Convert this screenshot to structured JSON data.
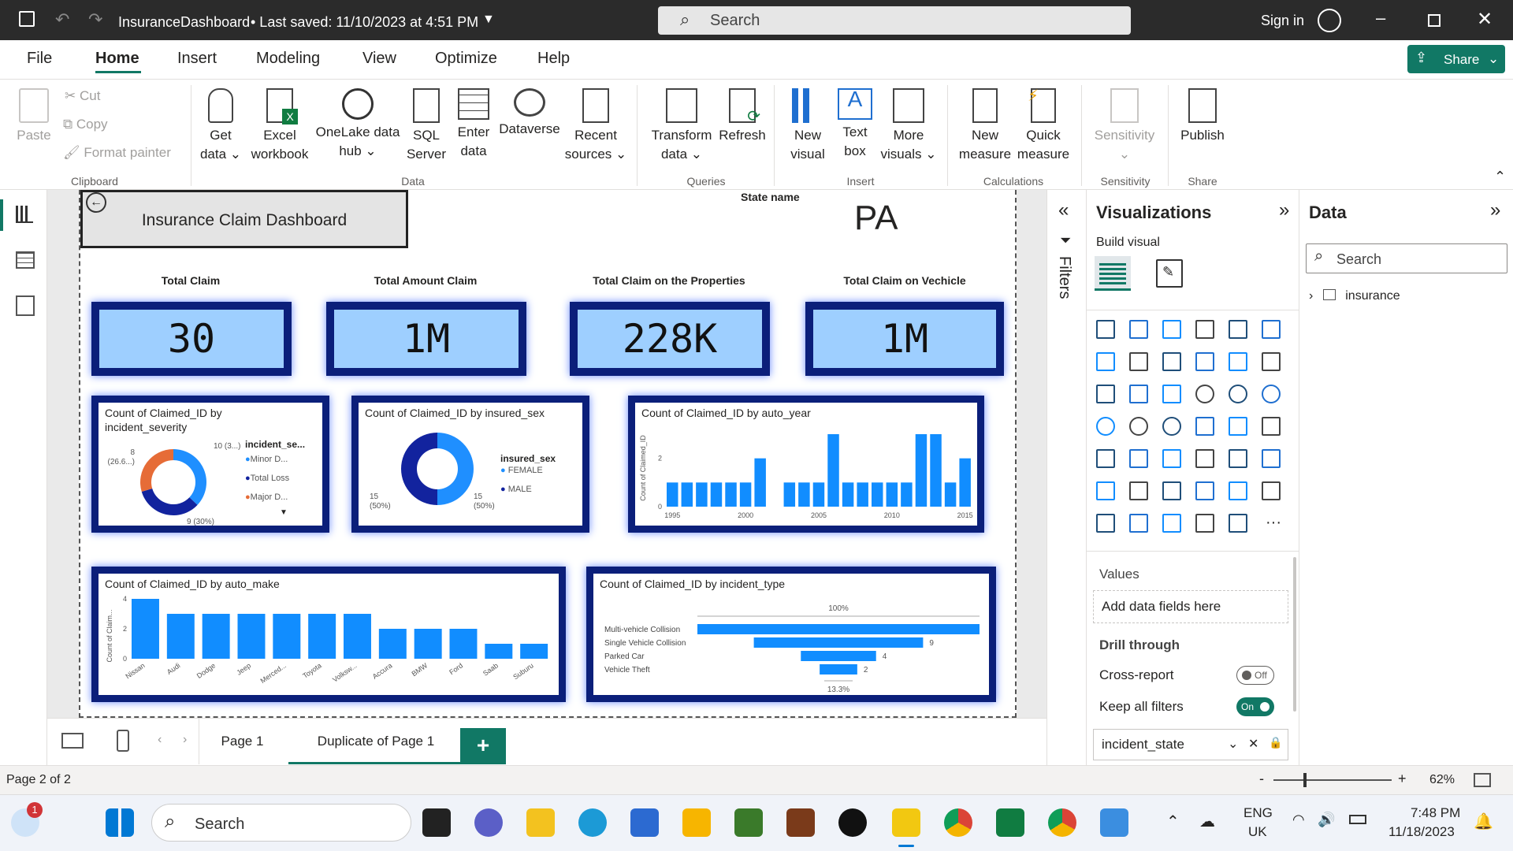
{
  "titlebar": {
    "file_title": "InsuranceDashboard",
    "saved_text": "• Last saved: 11/10/2023 at 4:51 PM",
    "search_placeholder": "Search",
    "signin": "Sign in"
  },
  "menu": {
    "tabs": [
      "File",
      "Home",
      "Insert",
      "Modeling",
      "View",
      "Optimize",
      "Help"
    ],
    "active": "Home",
    "share": "Share"
  },
  "ribbon": {
    "clipboard": {
      "paste": "Paste",
      "cut": "Cut",
      "copy": "Copy",
      "format_painter": "Format painter",
      "group": "Clipboard"
    },
    "data": {
      "get_data": [
        "Get",
        "data ⌄"
      ],
      "excel": [
        "Excel",
        "workbook"
      ],
      "onelake": [
        "OneLake data",
        "hub ⌄"
      ],
      "sql": [
        "SQL",
        "Server"
      ],
      "enter": [
        "Enter",
        "data"
      ],
      "dataverse": "Dataverse",
      "recent": [
        "Recent",
        "sources ⌄"
      ],
      "group": "Data"
    },
    "queries": {
      "transform": [
        "Transform",
        "data ⌄"
      ],
      "refresh": "Refresh",
      "group": "Queries"
    },
    "insert": {
      "new_visual": [
        "New",
        "visual"
      ],
      "text_box": [
        "Text",
        "box"
      ],
      "more_visuals": [
        "More",
        "visuals ⌄"
      ],
      "group": "Insert"
    },
    "calculations": {
      "new_measure": [
        "New",
        "measure"
      ],
      "quick_measure": [
        "Quick",
        "measure"
      ],
      "group": "Calculations"
    },
    "sensitivity": {
      "label": "Sensitivity",
      "group": "Sensitivity"
    },
    "share": {
      "publish": "Publish",
      "group": "Share"
    }
  },
  "report": {
    "title": "Insurance Claim Dashboard",
    "state_label": "State name",
    "state_value": "PA",
    "kpis": [
      {
        "title": "Total Claim",
        "value": "30"
      },
      {
        "title": "Total Amount Claim",
        "value": "1M"
      },
      {
        "title": "Total Claim on the Properties",
        "value": "228K"
      },
      {
        "title": "Total Claim on Vechicle",
        "value": "1M"
      }
    ]
  },
  "chart_data": [
    {
      "type": "pie",
      "title": "Count of Claimed_ID by incident_severity",
      "legend_title": "incident_se...",
      "categories": [
        "Minor D...",
        "Total Loss",
        "Major D..."
      ],
      "values": [
        10,
        9,
        8
      ],
      "data_labels": [
        "10 (3...)",
        "9 (30%)",
        "8 (26.6...)"
      ],
      "colors": [
        "#1f8fff",
        "#12239e",
        "#e66c37",
        "#6b007b"
      ]
    },
    {
      "type": "pie",
      "title": "Count of Claimed_ID by insured_sex",
      "legend_title": "insured_sex",
      "categories": [
        "FEMALE",
        "MALE"
      ],
      "values": [
        15,
        15
      ],
      "data_labels": [
        "15 (50%)",
        "15 (50%)"
      ],
      "colors": [
        "#1f8fff",
        "#12239e"
      ]
    },
    {
      "type": "bar",
      "title": "Count of Claimed_ID by auto_year",
      "ylabel": "Count of Claimed_ID",
      "x": [
        1995,
        1996,
        1997,
        1998,
        1999,
        2000,
        2001,
        2002,
        2003,
        2004,
        2005,
        2006,
        2007,
        2008,
        2009,
        2010,
        2011,
        2012,
        2013,
        2014,
        2015
      ],
      "values": [
        1,
        1,
        1,
        1,
        1,
        1,
        2,
        0,
        1,
        1,
        1,
        3,
        1,
        1,
        1,
        1,
        1,
        3,
        3,
        1,
        2
      ],
      "xticks": [
        "1995",
        "2000",
        "2005",
        "2010",
        "2015"
      ],
      "ylim": [
        0,
        3
      ],
      "yticks": [
        "0",
        "2"
      ]
    },
    {
      "type": "bar",
      "title": "Count of Claimed_ID by auto_make",
      "ylabel": "Count of Claim...",
      "categories": [
        "Nissan",
        "Audi",
        "Dodge",
        "Jeep",
        "Merced...",
        "Toyota",
        "Volksw...",
        "Accura",
        "BMW",
        "Ford",
        "Saab",
        "Suburu"
      ],
      "values": [
        4,
        3,
        3,
        3,
        3,
        3,
        3,
        2,
        2,
        2,
        1,
        1
      ],
      "ylim": [
        0,
        4
      ],
      "yticks": [
        "0",
        "2",
        "4"
      ]
    },
    {
      "type": "bar",
      "orientation": "horizontal",
      "title": "Count of Claimed_ID by incident_type",
      "categories": [
        "Multi-vehicle Collision",
        "Single Vehicle Collision",
        "Parked Car",
        "Vehicle Theft"
      ],
      "values": [
        15,
        9,
        4,
        2
      ],
      "data_labels": [
        "",
        "9",
        "4",
        "2"
      ],
      "top_label": "100%",
      "bottom_label": "13.3%"
    }
  ],
  "filters_label": "Filters",
  "visualizations": {
    "title": "Visualizations",
    "build_visual": "Build visual",
    "values_label": "Values",
    "add_fields": "Add data fields here",
    "drill_through": "Drill through",
    "cross_report": "Cross-report",
    "cross_report_state": "Off",
    "keep_filters": "Keep all filters",
    "keep_filters_state": "On",
    "field_well": "incident_state"
  },
  "data_pane": {
    "title": "Data",
    "search_placeholder": "Search",
    "tables": [
      "insurance"
    ]
  },
  "pages": {
    "tabs": [
      "Page 1",
      "Duplicate of Page 1"
    ],
    "active": "Duplicate of Page 1",
    "add": "+"
  },
  "status": {
    "page_info": "Page 2 of 2",
    "zoom": "62%"
  },
  "taskbar": {
    "search": "Search",
    "lang": [
      "ENG",
      "UK"
    ],
    "time": "7:48 PM",
    "date": "11/18/2023",
    "badge": "1"
  }
}
